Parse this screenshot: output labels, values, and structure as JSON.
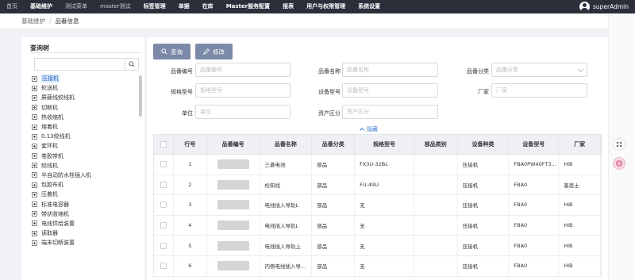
{
  "nav": {
    "items": [
      "首页",
      "基础维护",
      "测试菜单",
      "master测试",
      "标签管理",
      "单据",
      "在库",
      "Master服务配置",
      "报表",
      "用户与权限管理",
      "系统设置"
    ],
    "active_index": 1,
    "user": "superAdmin"
  },
  "breadcrumb": {
    "parent": "基础维护",
    "sep": "/",
    "current": "品番信息"
  },
  "left": {
    "title": "查询树",
    "search_value": "",
    "tree": [
      "压接机",
      "轮送机",
      "屏蔽线绞线机",
      "切断机",
      "热收缩机",
      "熔着机",
      "0.13绞线机",
      "套环机",
      "卷胶带机",
      "绞线机",
      "半自动防水栓插入机",
      "包胶布机",
      "压着机",
      "标准电容器",
      "带状收缩机",
      "电线供给装置",
      "读取器",
      "端末切断装置"
    ],
    "selected_index": 0
  },
  "toolbar": {
    "query": "查询",
    "edit": "修改"
  },
  "form": {
    "part_no": {
      "label": "品番编号",
      "placeholder": "品番编号"
    },
    "part_name": {
      "label": "品番名称",
      "placeholder": "品番名称"
    },
    "part_cat": {
      "label": "品番分类",
      "placeholder": "品番分类"
    },
    "spec": {
      "label": "规格型号",
      "placeholder": "规格型号"
    },
    "equip_model": {
      "label": "设备型号",
      "placeholder": "设备型号"
    },
    "maker": {
      "label": "厂家",
      "placeholder": "厂家"
    },
    "unit": {
      "label": "单位",
      "placeholder": "单位"
    },
    "asset": {
      "label": "资产区分",
      "placeholder": "资产区分"
    },
    "hide": "隐藏"
  },
  "table": {
    "headers": [
      "",
      "行号",
      "品番编号",
      "品番名称",
      "品番分类",
      "规格型号",
      "部品类别",
      "设备种类",
      "设备型号",
      "厂家"
    ],
    "rows": [
      {
        "no": "1",
        "name": "三菱电池",
        "cat": "部品",
        "spec": "FX3U-32BL",
        "kind": "",
        "equip": "压接机",
        "model": "FBA0PW40FT3...",
        "maker": "HIB"
      },
      {
        "no": "2",
        "name": "检知线",
        "cat": "部品",
        "spec": "FU-49U",
        "kind": "",
        "equip": "压接机",
        "model": "FBA0",
        "maker": "基恩士"
      },
      {
        "no": "3",
        "name": "电线插入导轨L",
        "cat": "部品",
        "spec": "无",
        "kind": "",
        "equip": "压接机",
        "model": "FBA0",
        "maker": "HIB"
      },
      {
        "no": "4",
        "name": "电线插入导轨L",
        "cat": "部品",
        "spec": "无",
        "kind": "",
        "equip": "压接机",
        "model": "FBA0",
        "maker": "HIB"
      },
      {
        "no": "5",
        "name": "电线插入导轨上",
        "cat": "部品",
        "spec": "无",
        "kind": "",
        "equip": "压接机",
        "model": "FBA0",
        "maker": "HIB"
      },
      {
        "no": "6",
        "name": "内侧电线插入导...",
        "cat": "部品",
        "spec": "无",
        "kind": "",
        "equip": "压接机",
        "model": "FBA0",
        "maker": "HIB"
      }
    ]
  },
  "colors": {
    "nav_bg": "#2b2f3a",
    "button": "#7b8aa8",
    "link": "#3a7bd5"
  }
}
